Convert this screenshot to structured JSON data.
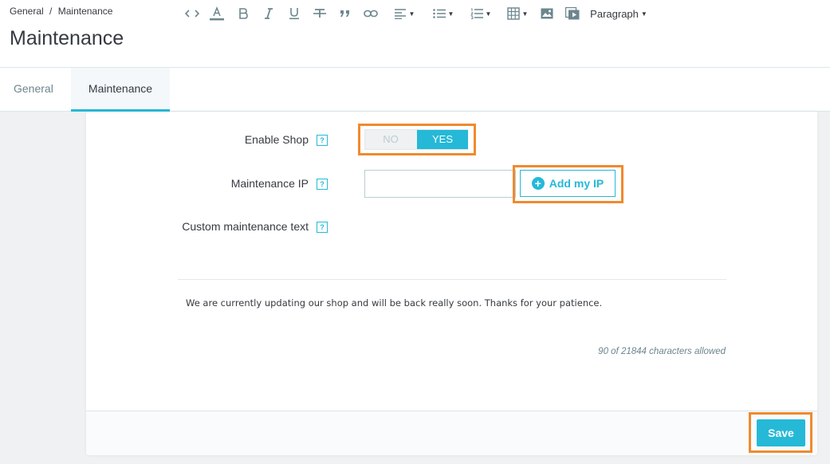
{
  "breadcrumb": {
    "parent": "General",
    "separator": "/",
    "current": "Maintenance"
  },
  "page": {
    "title": "Maintenance"
  },
  "tabs": [
    {
      "label": "General"
    },
    {
      "label": "Maintenance"
    }
  ],
  "form": {
    "enable_shop": {
      "label": "Enable Shop",
      "options": [
        "NO",
        "YES"
      ],
      "selected": "YES"
    },
    "maintenance_ip": {
      "label": "Maintenance IP",
      "value": "",
      "add_button_label": "Add my IP"
    },
    "custom_text": {
      "label": "Custom maintenance text"
    },
    "help_glyph": "?"
  },
  "editor": {
    "format_label": "Paragraph",
    "content": "We are currently updating our shop and will be back really soon. Thanks for your patience.",
    "char_count": "90 of 21844 characters allowed"
  },
  "footer": {
    "save_label": "Save"
  },
  "colors": {
    "accent": "#25b9d7",
    "highlight": "#f08a2e"
  }
}
